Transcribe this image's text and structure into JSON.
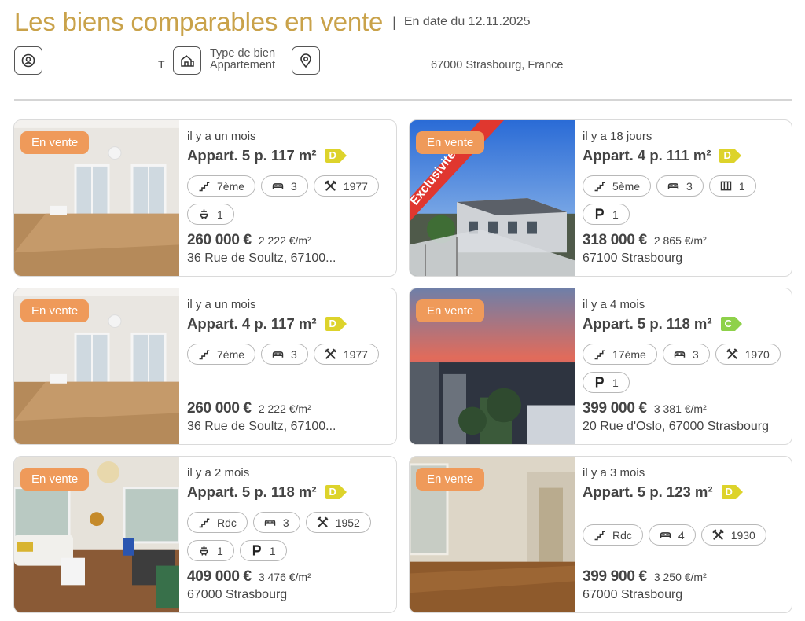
{
  "header": {
    "title": "Les biens comparables en vente",
    "separator": "|",
    "date": "En date du 12.11.2025"
  },
  "criteria": {
    "t_marker": "T",
    "type_label": "Type de bien",
    "type_value": "Appartement",
    "location": "67000 Strasbourg, France"
  },
  "colors": {
    "accent": "#c9a24a",
    "badge": "#ef9a5a",
    "dpe_D": "#ddd32b",
    "dpe_C": "#8ed14a"
  },
  "listings": [
    {
      "badge": "En vente",
      "ago": "il y a un mois",
      "title": "Appart. 5 p. 117 m²",
      "dpe": "D",
      "floor": "7ème",
      "beds": "3",
      "year": "1977",
      "baths": "1",
      "price": "260 000 €",
      "ppm": "2 222 €/m²",
      "address": "36 Rue de Soultz, 67100..."
    },
    {
      "badge": "En vente",
      "ribbon": "Exclusivité",
      "ago": "il y a 18 jours",
      "title": "Appart. 4 p. 111 m²",
      "dpe": "D",
      "floor": "5ème",
      "beds": "3",
      "rooms": "1",
      "parking": "1",
      "price": "318 000 €",
      "ppm": "2 865 €/m²",
      "address": "67100 Strasbourg"
    },
    {
      "badge": "En vente",
      "ago": "il y a un mois",
      "title": "Appart. 4 p. 117 m²",
      "dpe": "D",
      "floor": "7ème",
      "beds": "3",
      "year": "1977",
      "price": "260 000 €",
      "ppm": "2 222 €/m²",
      "address": "36 Rue de Soultz, 67100..."
    },
    {
      "badge": "En vente",
      "ago": "il y a 4 mois",
      "title": "Appart. 5 p. 118 m²",
      "dpe": "C",
      "floor": "17ème",
      "beds": "3",
      "year": "1970",
      "parking": "1",
      "price": "399 000 €",
      "ppm": "3 381 €/m²",
      "address": "20 Rue d'Oslo, 67000 Strasbourg"
    },
    {
      "badge": "En vente",
      "ago": "il y a 2 mois",
      "title": "Appart. 5 p. 118 m²",
      "dpe": "D",
      "floor": "Rdc",
      "beds": "3",
      "year": "1952",
      "baths": "1",
      "parking": "1",
      "price": "409 000 €",
      "ppm": "3 476 €/m²",
      "address": "67000 Strasbourg"
    },
    {
      "badge": "En vente",
      "ago": "il y a 3 mois",
      "title": "Appart. 5 p. 123 m²",
      "dpe": "D",
      "floor": "Rdc",
      "beds": "4",
      "year": "1930",
      "price": "399 900 €",
      "ppm": "3 250 €/m²",
      "address": "67000 Strasbourg"
    }
  ]
}
